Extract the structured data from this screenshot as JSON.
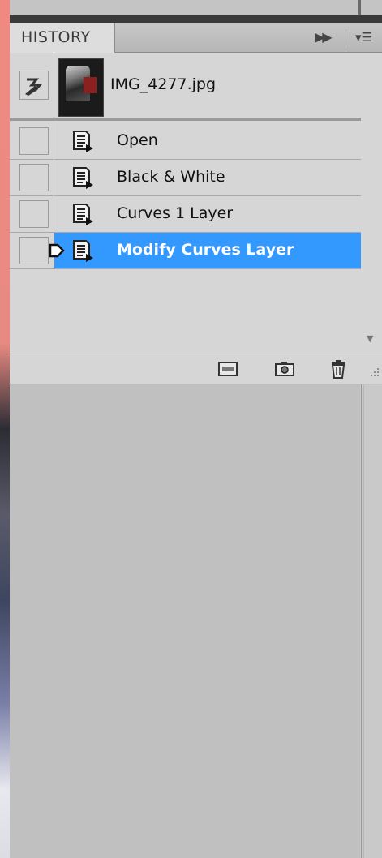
{
  "panel": {
    "tab_label": "HISTORY",
    "snapshot": {
      "name": "IMG_4277.jpg"
    },
    "states": [
      {
        "label": "Open",
        "selected": false
      },
      {
        "label": "Black & White",
        "selected": false
      },
      {
        "label": "Curves 1 Layer",
        "selected": false
      },
      {
        "label": "Modify Curves Layer",
        "selected": true
      }
    ]
  },
  "colors": {
    "selection": "#3399ff",
    "panel_bg": "#d6d6d6"
  },
  "icons": {
    "fast_forward": "fast-forward-icon",
    "panel_menu": "panel-menu-icon",
    "history_brush": "history-brush-icon",
    "state": "document-state-icon",
    "new_document": "new-document-icon",
    "snapshot": "camera-icon",
    "delete": "trash-icon"
  }
}
